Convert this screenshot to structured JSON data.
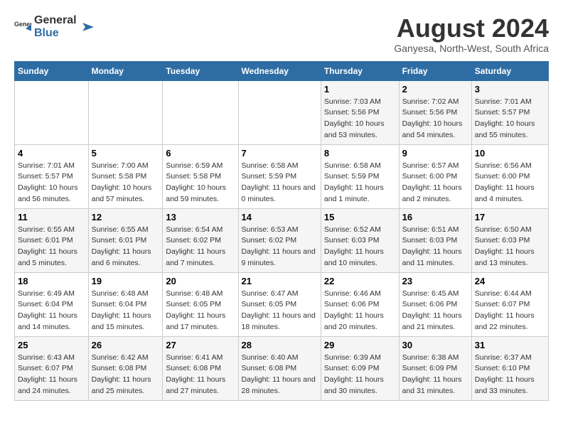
{
  "header": {
    "logo_general": "General",
    "logo_blue": "Blue",
    "title": "August 2024",
    "subtitle": "Ganyesa, North-West, South Africa"
  },
  "weekdays": [
    "Sunday",
    "Monday",
    "Tuesday",
    "Wednesday",
    "Thursday",
    "Friday",
    "Saturday"
  ],
  "weeks": [
    [
      {
        "day": "",
        "sunrise": "",
        "sunset": "",
        "daylight": ""
      },
      {
        "day": "",
        "sunrise": "",
        "sunset": "",
        "daylight": ""
      },
      {
        "day": "",
        "sunrise": "",
        "sunset": "",
        "daylight": ""
      },
      {
        "day": "",
        "sunrise": "",
        "sunset": "",
        "daylight": ""
      },
      {
        "day": "1",
        "sunrise": "Sunrise: 7:03 AM",
        "sunset": "Sunset: 5:56 PM",
        "daylight": "Daylight: 10 hours and 53 minutes."
      },
      {
        "day": "2",
        "sunrise": "Sunrise: 7:02 AM",
        "sunset": "Sunset: 5:56 PM",
        "daylight": "Daylight: 10 hours and 54 minutes."
      },
      {
        "day": "3",
        "sunrise": "Sunrise: 7:01 AM",
        "sunset": "Sunset: 5:57 PM",
        "daylight": "Daylight: 10 hours and 55 minutes."
      }
    ],
    [
      {
        "day": "4",
        "sunrise": "Sunrise: 7:01 AM",
        "sunset": "Sunset: 5:57 PM",
        "daylight": "Daylight: 10 hours and 56 minutes."
      },
      {
        "day": "5",
        "sunrise": "Sunrise: 7:00 AM",
        "sunset": "Sunset: 5:58 PM",
        "daylight": "Daylight: 10 hours and 57 minutes."
      },
      {
        "day": "6",
        "sunrise": "Sunrise: 6:59 AM",
        "sunset": "Sunset: 5:58 PM",
        "daylight": "Daylight: 10 hours and 59 minutes."
      },
      {
        "day": "7",
        "sunrise": "Sunrise: 6:58 AM",
        "sunset": "Sunset: 5:59 PM",
        "daylight": "Daylight: 11 hours and 0 minutes."
      },
      {
        "day": "8",
        "sunrise": "Sunrise: 6:58 AM",
        "sunset": "Sunset: 5:59 PM",
        "daylight": "Daylight: 11 hours and 1 minute."
      },
      {
        "day": "9",
        "sunrise": "Sunrise: 6:57 AM",
        "sunset": "Sunset: 6:00 PM",
        "daylight": "Daylight: 11 hours and 2 minutes."
      },
      {
        "day": "10",
        "sunrise": "Sunrise: 6:56 AM",
        "sunset": "Sunset: 6:00 PM",
        "daylight": "Daylight: 11 hours and 4 minutes."
      }
    ],
    [
      {
        "day": "11",
        "sunrise": "Sunrise: 6:55 AM",
        "sunset": "Sunset: 6:01 PM",
        "daylight": "Daylight: 11 hours and 5 minutes."
      },
      {
        "day": "12",
        "sunrise": "Sunrise: 6:55 AM",
        "sunset": "Sunset: 6:01 PM",
        "daylight": "Daylight: 11 hours and 6 minutes."
      },
      {
        "day": "13",
        "sunrise": "Sunrise: 6:54 AM",
        "sunset": "Sunset: 6:02 PM",
        "daylight": "Daylight: 11 hours and 7 minutes."
      },
      {
        "day": "14",
        "sunrise": "Sunrise: 6:53 AM",
        "sunset": "Sunset: 6:02 PM",
        "daylight": "Daylight: 11 hours and 9 minutes."
      },
      {
        "day": "15",
        "sunrise": "Sunrise: 6:52 AM",
        "sunset": "Sunset: 6:03 PM",
        "daylight": "Daylight: 11 hours and 10 minutes."
      },
      {
        "day": "16",
        "sunrise": "Sunrise: 6:51 AM",
        "sunset": "Sunset: 6:03 PM",
        "daylight": "Daylight: 11 hours and 11 minutes."
      },
      {
        "day": "17",
        "sunrise": "Sunrise: 6:50 AM",
        "sunset": "Sunset: 6:03 PM",
        "daylight": "Daylight: 11 hours and 13 minutes."
      }
    ],
    [
      {
        "day": "18",
        "sunrise": "Sunrise: 6:49 AM",
        "sunset": "Sunset: 6:04 PM",
        "daylight": "Daylight: 11 hours and 14 minutes."
      },
      {
        "day": "19",
        "sunrise": "Sunrise: 6:48 AM",
        "sunset": "Sunset: 6:04 PM",
        "daylight": "Daylight: 11 hours and 15 minutes."
      },
      {
        "day": "20",
        "sunrise": "Sunrise: 6:48 AM",
        "sunset": "Sunset: 6:05 PM",
        "daylight": "Daylight: 11 hours and 17 minutes."
      },
      {
        "day": "21",
        "sunrise": "Sunrise: 6:47 AM",
        "sunset": "Sunset: 6:05 PM",
        "daylight": "Daylight: 11 hours and 18 minutes."
      },
      {
        "day": "22",
        "sunrise": "Sunrise: 6:46 AM",
        "sunset": "Sunset: 6:06 PM",
        "daylight": "Daylight: 11 hours and 20 minutes."
      },
      {
        "day": "23",
        "sunrise": "Sunrise: 6:45 AM",
        "sunset": "Sunset: 6:06 PM",
        "daylight": "Daylight: 11 hours and 21 minutes."
      },
      {
        "day": "24",
        "sunrise": "Sunrise: 6:44 AM",
        "sunset": "Sunset: 6:07 PM",
        "daylight": "Daylight: 11 hours and 22 minutes."
      }
    ],
    [
      {
        "day": "25",
        "sunrise": "Sunrise: 6:43 AM",
        "sunset": "Sunset: 6:07 PM",
        "daylight": "Daylight: 11 hours and 24 minutes."
      },
      {
        "day": "26",
        "sunrise": "Sunrise: 6:42 AM",
        "sunset": "Sunset: 6:08 PM",
        "daylight": "Daylight: 11 hours and 25 minutes."
      },
      {
        "day": "27",
        "sunrise": "Sunrise: 6:41 AM",
        "sunset": "Sunset: 6:08 PM",
        "daylight": "Daylight: 11 hours and 27 minutes."
      },
      {
        "day": "28",
        "sunrise": "Sunrise: 6:40 AM",
        "sunset": "Sunset: 6:08 PM",
        "daylight": "Daylight: 11 hours and 28 minutes."
      },
      {
        "day": "29",
        "sunrise": "Sunrise: 6:39 AM",
        "sunset": "Sunset: 6:09 PM",
        "daylight": "Daylight: 11 hours and 30 minutes."
      },
      {
        "day": "30",
        "sunrise": "Sunrise: 6:38 AM",
        "sunset": "Sunset: 6:09 PM",
        "daylight": "Daylight: 11 hours and 31 minutes."
      },
      {
        "day": "31",
        "sunrise": "Sunrise: 6:37 AM",
        "sunset": "Sunset: 6:10 PM",
        "daylight": "Daylight: 11 hours and 33 minutes."
      }
    ]
  ]
}
